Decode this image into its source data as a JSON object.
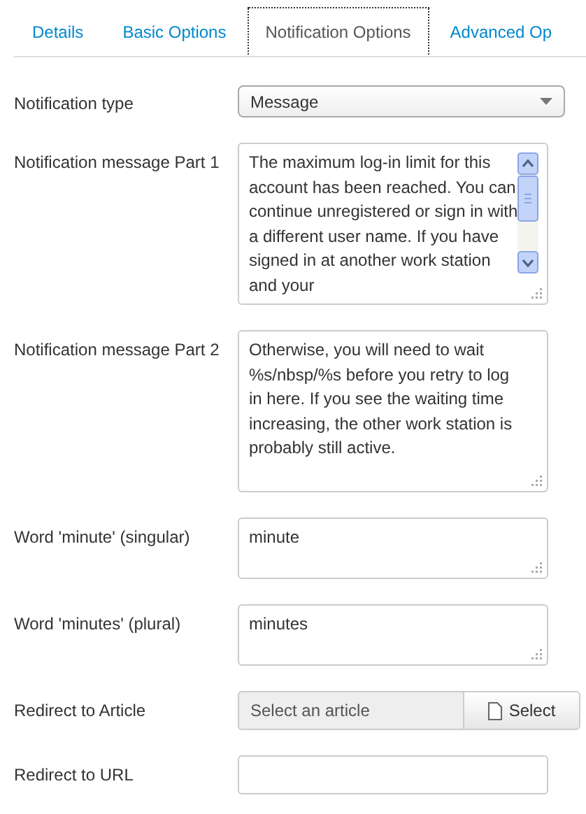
{
  "tabs": [
    {
      "label": "Details",
      "selected": false
    },
    {
      "label": "Basic Options",
      "selected": false
    },
    {
      "label": "Notification Options",
      "selected": true
    },
    {
      "label": "Advanced Op",
      "selected": false
    }
  ],
  "fields": [
    {
      "kind": "select",
      "label": "Notification type",
      "value": "Message"
    },
    {
      "kind": "textarea",
      "label": "Notification message Part 1",
      "value": "The maximum log-in limit for this account has been reached. You can continue unregistered or sign in with a different user name. If you have signed in at another work station and your",
      "scrollbar": true
    },
    {
      "kind": "textarea",
      "label": "Notification message Part 2",
      "value": "Otherwise, you will need to wait %s/nbsp/%s before you retry to log in here. If you see the waiting time increasing, the other work station is probably still active.",
      "scrollbar": false
    },
    {
      "kind": "short-textarea",
      "label": "Word 'minute' (singular)",
      "value": "minute"
    },
    {
      "kind": "short-textarea",
      "label": "Word 'minutes' (plural)",
      "value": "minutes"
    },
    {
      "kind": "picker",
      "label": "Redirect to Article",
      "placeholder": "Select an article",
      "button": "Select"
    },
    {
      "kind": "input",
      "label": "Redirect to URL"
    }
  ]
}
